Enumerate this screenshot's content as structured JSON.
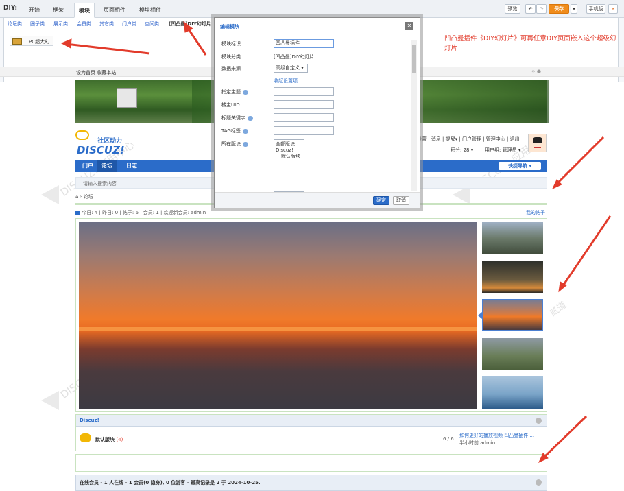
{
  "diy": {
    "label": "DIY:",
    "tabs": [
      "开始",
      "框架",
      "模块",
      "页面相件",
      "模块相件"
    ],
    "active_tab": "模块",
    "subtabs": [
      "论坛类",
      "圈子类",
      "展示类",
      "会员类",
      "其它类",
      "门户类",
      "空间类",
      "[凹凸曼]DIY幻灯片"
    ],
    "selected_subtab": "[凹凸曼]DIY幻灯片",
    "module_item": "PC超大幻",
    "right_buttons": {
      "preview": "预览",
      "undo": "↶",
      "redo": "↷",
      "save": "保存",
      "mobile": "手机版",
      "close": "✕"
    }
  },
  "annotation": "凹凸曼插件《DIY幻灯片》可再任意DIY页面嵌入这个超级幻灯片",
  "site_toplinks": "设为首页  收藏本站",
  "header": {
    "logo_top": "社区动力",
    "logo_main": "DISCUZ!",
    "user_links": [
      "设置",
      "消息",
      "提醒",
      "门户管理",
      "管理中心",
      "退出"
    ],
    "points": "积分: 28",
    "usergroup": "用户组: 管理员"
  },
  "nav": {
    "items": [
      "门户",
      "论坛",
      "日志"
    ],
    "active": "论坛",
    "quick": "快捷导航"
  },
  "search_placeholder": "请输入搜索内容",
  "breadcrumb": "论坛",
  "stats": {
    "text": "今日: 4 | 昨日: 0 | 帖子: 6 | 会员: 1 | 欢迎新会员: admin",
    "my_posts": "我的帖子"
  },
  "forum": {
    "category": "Discuz!",
    "board": "默认版块",
    "board_count": "(4)",
    "ratio": "6 / 6",
    "last_post": "如何更好的播放视频 凹凸曼插件 ...",
    "last_meta": "半小时前 admin"
  },
  "online": "在线会员 - 1 人在线 - 1 会员(0 隐身), 0 位游客 - 最高记录是 2 于 2024-10-25.",
  "watermark": [
    "DISCUZ! 应用中心",
    "addon.dismall.com",
    "贰道"
  ],
  "dialog": {
    "title": "编辑模块",
    "fields": {
      "id_label": "模块标识",
      "id_value": "凹凸曼插件",
      "category_label": "模块分类",
      "category_value": "[凹凸曼]DIY幻灯片",
      "source_label": "数据来源",
      "source_value": "高级自定义",
      "collapse_link": "收起设置项",
      "topic_label": "指定主题",
      "uid_label": "楼主UID",
      "keyword_label": "标题关键字",
      "tag_label": "TAG标签",
      "board_label": "所在版块",
      "board_options": [
        "全部版块",
        "Discuz!",
        "默认版块"
      ]
    },
    "ok": "确定",
    "cancel": "取消"
  },
  "colors": {
    "accent_orange": "#f08c1b",
    "nav_blue": "#2b6cc9",
    "annotation_red": "#e23b2b"
  }
}
